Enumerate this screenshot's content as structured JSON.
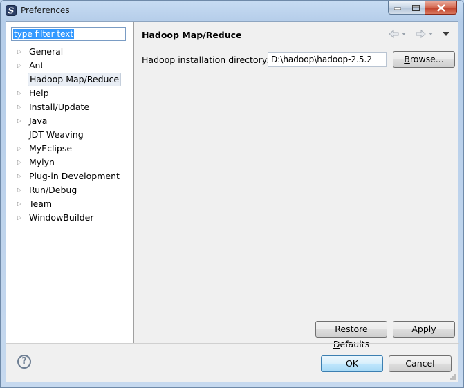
{
  "window": {
    "title": "Preferences"
  },
  "filter": {
    "text": "type filter text"
  },
  "tree": [
    {
      "label": "General",
      "expandable": true
    },
    {
      "label": "Ant",
      "expandable": true
    },
    {
      "label": "Hadoop Map/Reduce",
      "expandable": false,
      "selected": true
    },
    {
      "label": "Help",
      "expandable": true
    },
    {
      "label": "Install/Update",
      "expandable": true
    },
    {
      "label": "Java",
      "expandable": true
    },
    {
      "label": "JDT Weaving",
      "expandable": false
    },
    {
      "label": "MyEclipse",
      "expandable": true
    },
    {
      "label": "Mylyn",
      "expandable": true
    },
    {
      "label": "Plug-in Development",
      "expandable": true
    },
    {
      "label": "Run/Debug",
      "expandable": true
    },
    {
      "label": "Team",
      "expandable": true
    },
    {
      "label": "WindowBuilder",
      "expandable": true
    }
  ],
  "page": {
    "title": "Hadoop Map/Reduce",
    "field_label_mnemonic": "H",
    "field_label_rest": "adoop installation directory:",
    "field_value": "D:\\hadoop\\hadoop-2.5.2",
    "browse_mnemonic": "B",
    "browse_rest": "rowse...",
    "restore_prefix": "Restore ",
    "restore_mnemonic": "D",
    "restore_rest": "efaults",
    "apply_mnemonic": "A",
    "apply_rest": "pply"
  },
  "dialog": {
    "ok_label": "OK",
    "cancel_label": "Cancel",
    "help_glyph": "?"
  },
  "colors": {
    "selection": "#3399ff",
    "accent_border": "#3c7fb1",
    "close_button": "#c0402a"
  }
}
